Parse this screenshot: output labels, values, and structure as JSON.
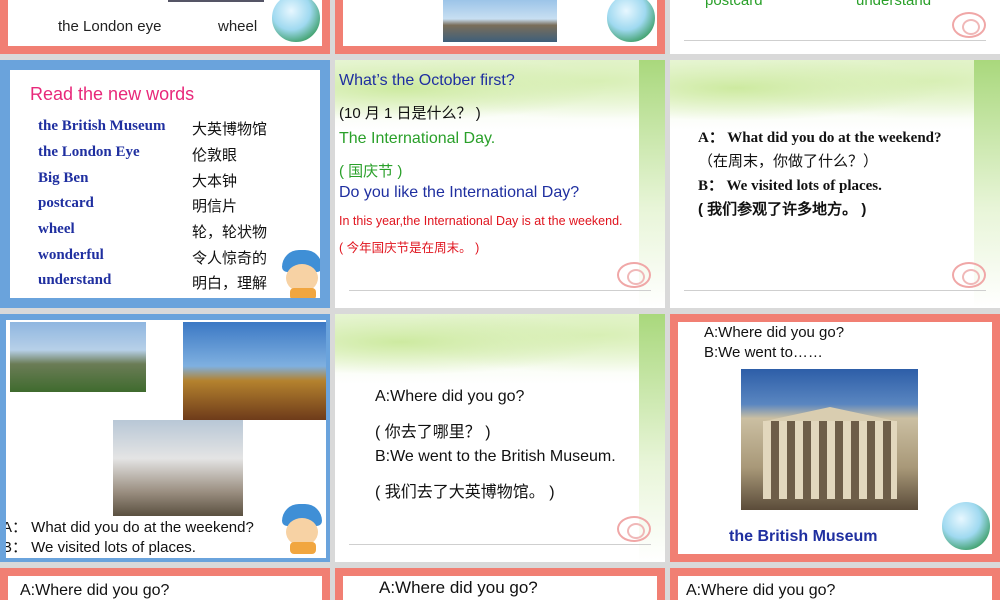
{
  "slide_top_left": {
    "label_left": "the London eye",
    "label_right": "wheel"
  },
  "slide_top_right": {
    "word_left": "postcard",
    "word_right": "understand"
  },
  "vocab": {
    "heading": "Read the new words",
    "rows": [
      {
        "en": "the British Museum",
        "zh": "大英博物馆"
      },
      {
        "en": "the London  Eye",
        "zh": "伦敦眼"
      },
      {
        "en": "Big Ben",
        "zh": "大本钟"
      },
      {
        "en": "postcard",
        "zh": "明信片"
      },
      {
        "en": "wheel",
        "zh": "轮，轮状物"
      },
      {
        "en": "wonderful",
        "zh": "令人惊奇的"
      },
      {
        "en": "understand",
        "zh": "明白，理解"
      }
    ]
  },
  "october": {
    "q": "What’s the October first?",
    "q_zh": "(10 月 1 日是什么？ )",
    "a": "The International Day.",
    "a_zh": "( 国庆节 )",
    "q2": "Do you like the International Day?",
    "note": "In this year,the International Day is at the weekend.",
    "note_zh": "( 今年国庆节是在周末。 )"
  },
  "weekend": {
    "a_line": "A： What did you do at the weekend?",
    "a_zh": "（在周末，你做了什么？）",
    "b_line": "B： We visited lots of places.",
    "b_zh": "( 我们参观了许多地方。 )"
  },
  "photos_slide": {
    "a_line": "A： What did you do at the weekend?",
    "b_line": "B： We visited lots of places."
  },
  "where": {
    "q": "A:Where did you go?",
    "q_zh": "( 你去了哪里？ )",
    "a": "B:We went to the British Museum.",
    "a_zh": "( 我们去了大英博物馆。 )"
  },
  "museum": {
    "q": "A:Where did you go?",
    "a": "B:We went to……",
    "caption": "the British Museum"
  },
  "bottom": {
    "left": "A:Where did you go?",
    "mid": "A:Where did you go?",
    "right": "A:Where did you go?"
  },
  "colors": {
    "salmon": "#f17f73",
    "blue": "#6aa3dc",
    "navy": "#1f2fa0",
    "green": "#2aa02a",
    "red": "#e0141e",
    "pink": "#e8287a"
  }
}
